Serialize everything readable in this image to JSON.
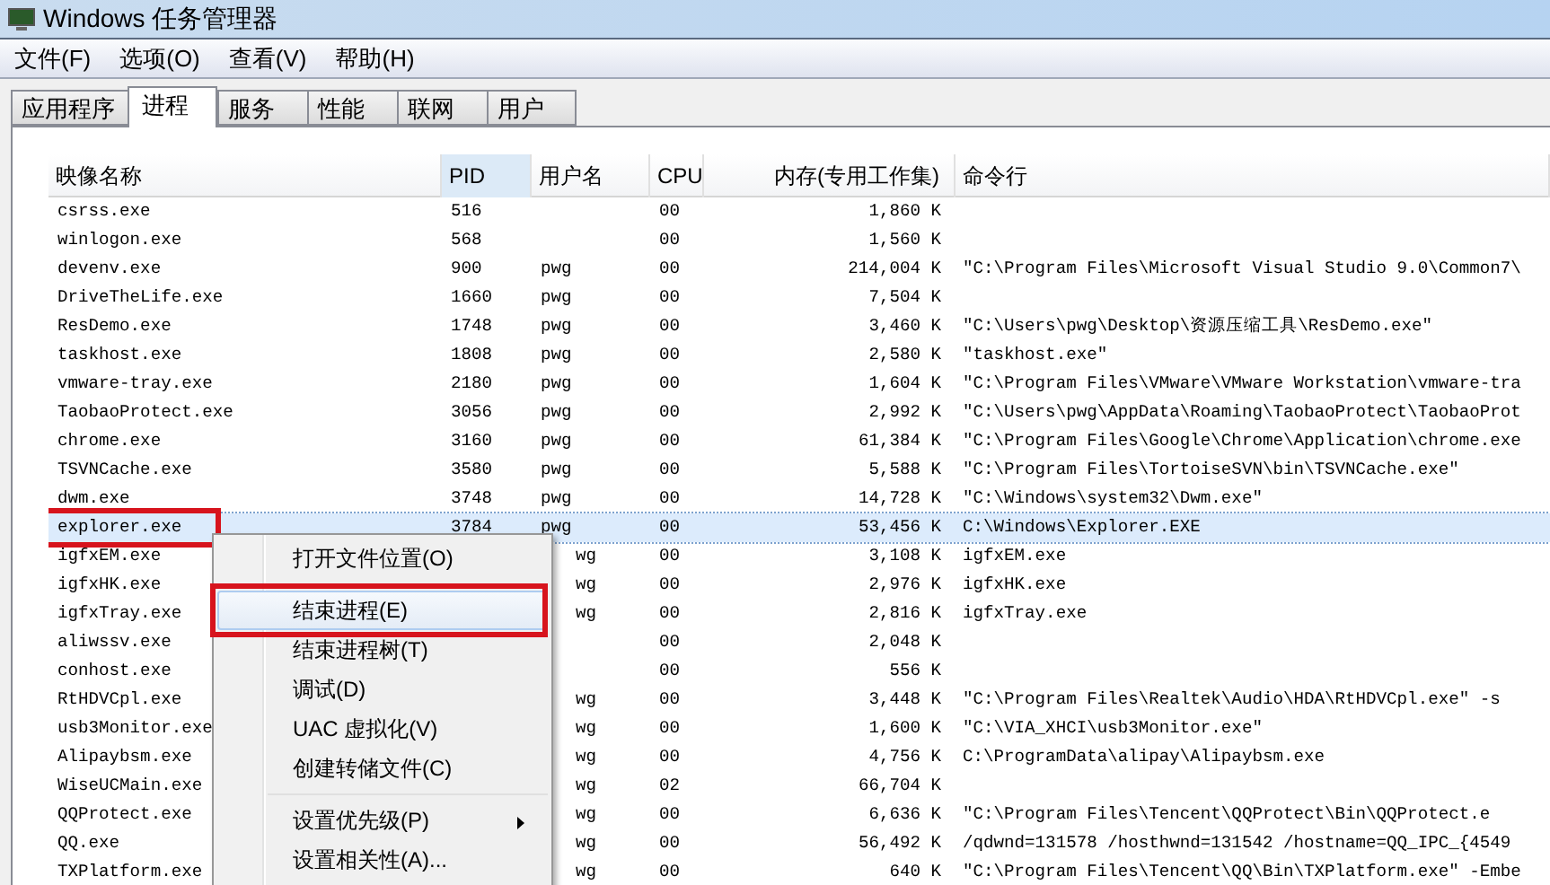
{
  "window": {
    "title": "Windows 任务管理器"
  },
  "menu_bar": [
    "文件(F)",
    "选项(O)",
    "查看(V)",
    "帮助(H)"
  ],
  "tabs": [
    {
      "label": "应用程序",
      "selected": false
    },
    {
      "label": "进程",
      "selected": true
    },
    {
      "label": "服务",
      "selected": false
    },
    {
      "label": "性能",
      "selected": false
    },
    {
      "label": "联网",
      "selected": false
    },
    {
      "label": "用户",
      "selected": false
    }
  ],
  "table": {
    "columns": [
      "映像名称",
      "PID",
      "用户名",
      "CPU",
      "内存(专用工作集)",
      "命令行"
    ],
    "rows": [
      {
        "name": "csrss.exe",
        "pid": "516",
        "cpu": "00",
        "memory": "1,860 K",
        "selected": false,
        "annotated": false
      },
      {
        "name": "winlogon.exe",
        "pid": "568",
        "cpu": "00",
        "memory": "1,560 K",
        "selected": false,
        "annotated": false
      },
      {
        "name": "devenv.exe",
        "pid": "900",
        "user": "pwg",
        "cpu": "00",
        "memory": "214,004 K",
        "command": "\"C:\\Program Files\\Microsoft Visual Studio 9.0\\Common7\\",
        "selected": false,
        "annotated": false
      },
      {
        "name": "DriveTheLife.exe",
        "pid": "1660",
        "user": "pwg",
        "cpu": "00",
        "memory": "7,504 K",
        "selected": false,
        "annotated": false
      },
      {
        "name": "ResDemo.exe",
        "pid": "1748",
        "user": "pwg",
        "cpu": "00",
        "memory": "3,460 K",
        "command": "\"C:\\Users\\pwg\\Desktop\\资源压缩工具\\ResDemo.exe\"",
        "selected": false,
        "annotated": false
      },
      {
        "name": "taskhost.exe",
        "pid": "1808",
        "user": "pwg",
        "cpu": "00",
        "memory": "2,580 K",
        "command": "\"taskhost.exe\"",
        "selected": false,
        "annotated": false
      },
      {
        "name": "vmware-tray.exe",
        "pid": "2180",
        "user": "pwg",
        "cpu": "00",
        "memory": "1,604 K",
        "command": "\"C:\\Program Files\\VMware\\VMware Workstation\\vmware-tra",
        "selected": false,
        "annotated": false
      },
      {
        "name": "TaobaoProtect.exe",
        "pid": "3056",
        "user": "pwg",
        "cpu": "00",
        "memory": "2,992 K",
        "command": "\"C:\\Users\\pwg\\AppData\\Roaming\\TaobaoProtect\\TaobaoProt",
        "selected": false,
        "annotated": false
      },
      {
        "name": "chrome.exe",
        "pid": "3160",
        "user": "pwg",
        "cpu": "00",
        "memory": "61,384 K",
        "command": "\"C:\\Program Files\\Google\\Chrome\\Application\\chrome.exe",
        "selected": false,
        "annotated": false
      },
      {
        "name": "TSVNCache.exe",
        "pid": "3580",
        "user": "pwg",
        "cpu": "00",
        "memory": "5,588 K",
        "command": "\"C:\\Program Files\\TortoiseSVN\\bin\\TSVNCache.exe\"",
        "selected": false,
        "annotated": false
      },
      {
        "name": "dwm.exe",
        "pid": "3748",
        "user": "pwg",
        "cpu": "00",
        "memory": "14,728 K",
        "command": "\"C:\\Windows\\system32\\Dwm.exe\"",
        "selected": false,
        "annotated": false
      },
      {
        "name": "explorer.exe",
        "pid": "3784",
        "user": "pwg",
        "cpu": "00",
        "memory": "53,456 K",
        "command": "C:\\Windows\\Explorer.EXE",
        "selected": true,
        "annotated": true
      },
      {
        "name": "igfxEM.exe",
        "user": "wg",
        "cpu": "00",
        "memory": "3,108 K",
        "command": "igfxEM.exe",
        "selected": false,
        "annotated": false
      },
      {
        "name": "igfxHK.exe",
        "user": "wg",
        "cpu": "00",
        "memory": "2,976 K",
        "command": "igfxHK.exe",
        "selected": false,
        "annotated": false
      },
      {
        "name": "igfxTray.exe",
        "user": "wg",
        "cpu": "00",
        "memory": "2,816 K",
        "command": "igfxTray.exe",
        "selected": false,
        "annotated": false
      },
      {
        "name": "aliwssv.exe",
        "cpu": "00",
        "memory": "2,048 K",
        "selected": false,
        "annotated": false
      },
      {
        "name": "conhost.exe",
        "cpu": "00",
        "memory": "556 K",
        "selected": false,
        "annotated": false
      },
      {
        "name": "RtHDVCpl.exe",
        "user": "wg",
        "cpu": "00",
        "memory": "3,448 K",
        "command": "\"C:\\Program Files\\Realtek\\Audio\\HDA\\RtHDVCpl.exe\" -s",
        "selected": false,
        "annotated": false
      },
      {
        "name": "usb3Monitor.exe",
        "user": "wg",
        "cpu": "00",
        "memory": "1,600 K",
        "command": "\"C:\\VIA_XHCI\\usb3Monitor.exe\"",
        "selected": false,
        "annotated": false
      },
      {
        "name": "Alipaybsm.exe",
        "user": "wg",
        "cpu": "00",
        "memory": "4,756 K",
        "command": "C:\\ProgramData\\alipay\\Alipaybsm.exe",
        "selected": false,
        "annotated": false
      },
      {
        "name": "WiseUCMain.exe",
        "user": "wg",
        "cpu": "02",
        "memory": "66,704 K",
        "selected": false,
        "annotated": false
      },
      {
        "name": "QQProtect.exe",
        "user": "wg",
        "cpu": "00",
        "memory": "6,636 K",
        "command": "\"C:\\Program Files\\Tencent\\QQProtect\\Bin\\QQProtect.e",
        "selected": false,
        "annotated": false
      },
      {
        "name": "QQ.exe",
        "user": "wg",
        "cpu": "00",
        "memory": "56,492 K",
        "command": "/qdwnd=131578  /hosthwnd=131542 /hostname=QQ_IPC_{4549",
        "selected": false,
        "annotated": false
      },
      {
        "name": "TXPlatform.exe",
        "user": "wg",
        "cpu": "00",
        "memory": "640 K",
        "command": "\"C:\\Program Files\\Tencent\\QQ\\Bin\\TXPlatform.exe\" -Embe",
        "selected": false,
        "annotated": false
      }
    ]
  },
  "context_menu": {
    "items": [
      {
        "kind": "item",
        "label": "打开文件位置(O)",
        "selected": false,
        "annotated": false
      },
      {
        "kind": "separator"
      },
      {
        "kind": "item",
        "label": "结束进程(E)",
        "selected": true,
        "annotated": true
      },
      {
        "kind": "item",
        "label": "结束进程树(T)",
        "selected": false,
        "annotated": false
      },
      {
        "kind": "item",
        "label": "调试(D)",
        "selected": false,
        "annotated": false
      },
      {
        "kind": "item",
        "label": "UAC 虚拟化(V)",
        "selected": false,
        "annotated": false
      },
      {
        "kind": "item",
        "label": "创建转储文件(C)",
        "selected": false,
        "annotated": false
      },
      {
        "kind": "separator"
      },
      {
        "kind": "submenu",
        "label": "设置优先级(P)",
        "selected": false,
        "annotated": false
      },
      {
        "kind": "item",
        "label": "设置相关性(A)...",
        "selected": false,
        "annotated": false
      }
    ]
  }
}
